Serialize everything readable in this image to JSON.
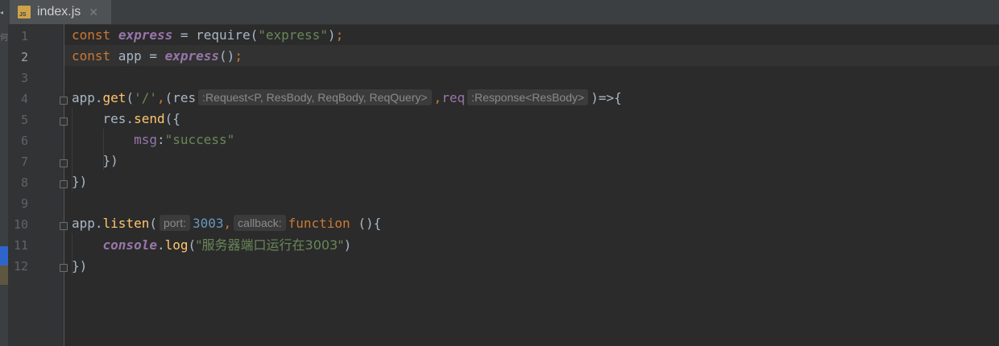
{
  "tab": {
    "filename": "index.js",
    "icon_text": "JS",
    "close": "✕",
    "scroll_arrow": "◂"
  },
  "left_strip": {
    "glyph": "何"
  },
  "editor": {
    "current_line": 2,
    "line_numbers": [
      "1",
      "2",
      "3",
      "4",
      "5",
      "6",
      "7",
      "8",
      "9",
      "10",
      "11",
      "12"
    ],
    "lines": {
      "l1": {
        "kw": "const",
        "name": "express",
        "eq": " = require(",
        "str": "\"express\"",
        "close": ")",
        "semi": ";"
      },
      "l2": {
        "kw": "const",
        "name": " app = ",
        "fn": "express",
        "call": "()",
        "semi": ";"
      },
      "l4": {
        "obj": "app.",
        "method": "get",
        "open": "(",
        "path": "'/'",
        "comma": ",",
        "paren": "(res",
        "hint_req": ":Request<P, ResBody, ReqBody, ReqQuery>",
        "comma2": ",",
        "param2": "req",
        "hint_res": ":Response<ResBody>",
        "arrow": ")=>{"
      },
      "l5": {
        "obj": "res.",
        "method": "send",
        "open": "({"
      },
      "l6": {
        "key": "msg",
        "colon": ":",
        "value": "\"success\""
      },
      "l7": {
        "close": "})"
      },
      "l8": {
        "close": "})"
      },
      "l10": {
        "obj": "app.",
        "method": "listen",
        "open": "(",
        "hint_port": "port:",
        "port": "3003",
        "comma": ",",
        "hint_cb": "callback:",
        "kw": "function",
        "rest": " (){"
      },
      "l11": {
        "obj": "console",
        "dot": ".",
        "method": "log",
        "open": "(",
        "str": "\"服务器端口运行在3003\"",
        "close": ")"
      },
      "l12": {
        "close": "})"
      }
    }
  }
}
